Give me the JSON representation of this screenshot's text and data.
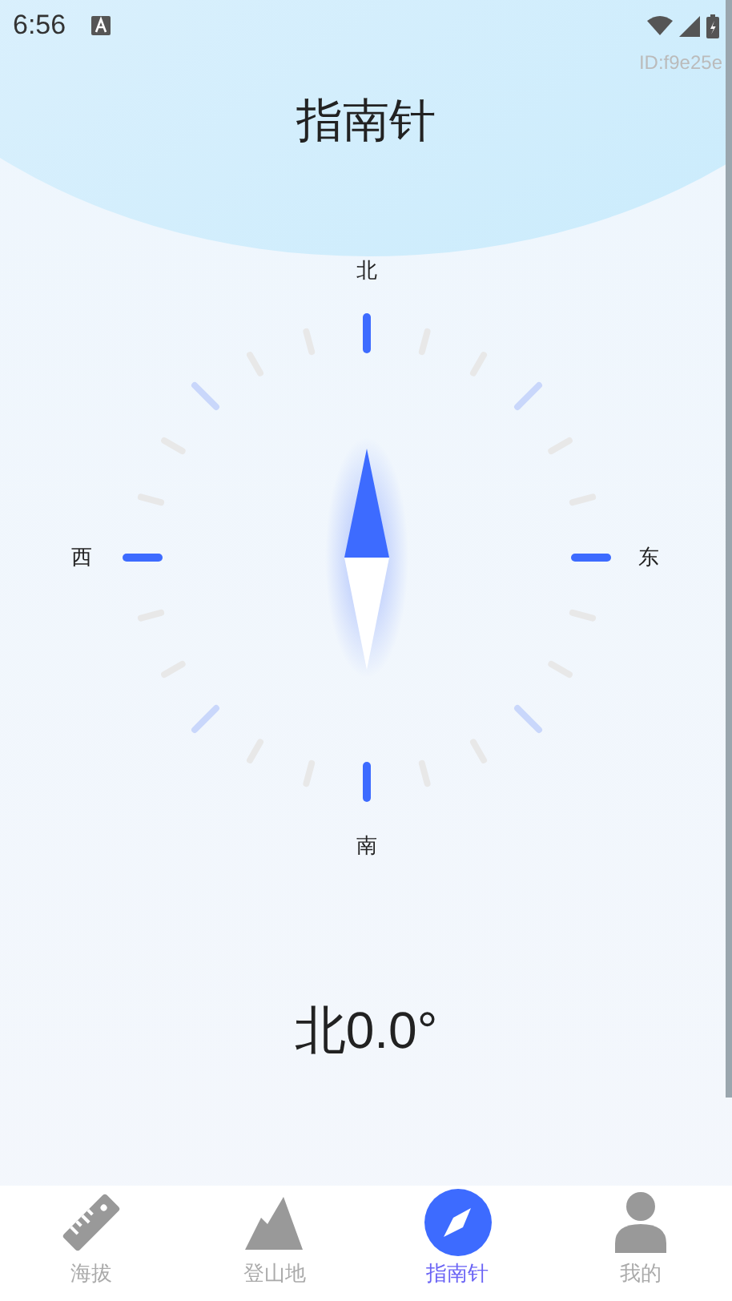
{
  "status_bar": {
    "time": "6:56"
  },
  "debug_id": "ID:f9e25e",
  "title": "指南针",
  "compass": {
    "north": "北",
    "south": "南",
    "west": "西",
    "east": "东"
  },
  "heading": "北0.0°",
  "nav": [
    {
      "kind": "ruler",
      "label": "海拔",
      "selected": false
    },
    {
      "kind": "mountain",
      "label": "登山地",
      "selected": false
    },
    {
      "kind": "compass",
      "label": "指南针",
      "selected": true
    },
    {
      "kind": "person",
      "label": "我的",
      "selected": false
    }
  ]
}
